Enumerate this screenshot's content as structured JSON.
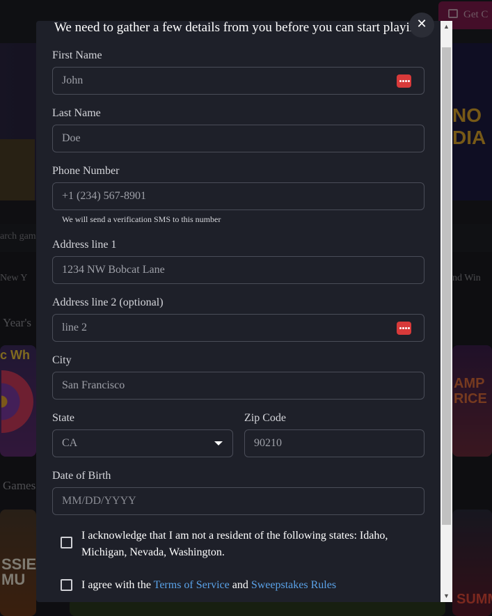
{
  "background": {
    "get_button_label": "Get C",
    "search_placeholder": "arch gam",
    "filter_left": "New Y",
    "filter_right": "nd Win",
    "section_1": "Year's",
    "section_2": "Games",
    "banner_text": "NO\nDIA",
    "tile_text_1": "c Wh",
    "tile_text_2": "AMP\nRICE",
    "tile_text_3": "SSIE\nMU",
    "tile_text_4": "SUMMO"
  },
  "modal": {
    "intro": "We need to gather a few details from you before you can start playing",
    "close_glyph": "✕",
    "fields": {
      "first_name": {
        "label": "First Name",
        "value": "John"
      },
      "last_name": {
        "label": "Last Name",
        "value": "Doe"
      },
      "phone": {
        "label": "Phone Number",
        "value": "+1 (234) 567-8901",
        "hint": "We will send a verification SMS to this number"
      },
      "address1": {
        "label": "Address line 1",
        "value": "1234 NW Bobcat Lane"
      },
      "address2": {
        "label": "Address line 2 (optional)",
        "value": "line 2"
      },
      "city": {
        "label": "City",
        "value": "San Francisco"
      },
      "state": {
        "label": "State",
        "value": "CA"
      },
      "zip": {
        "label": "Zip Code",
        "value": "90210"
      },
      "dob": {
        "label": "Date of Birth",
        "placeholder": "MM/DD/YYYY"
      }
    },
    "acknowledge_text": "I acknowledge that I am not a resident of the following states: Idaho, Michigan, Nevada, Washington.",
    "agree": {
      "prefix": "I agree with the ",
      "terms": "Terms of Service",
      "middle": " and ",
      "rules": "Sweepstakes Rules"
    }
  },
  "colors": {
    "modal_bg": "#1e2029",
    "link": "#5aa2e8",
    "password_manager_icon": "#d83a3a"
  }
}
